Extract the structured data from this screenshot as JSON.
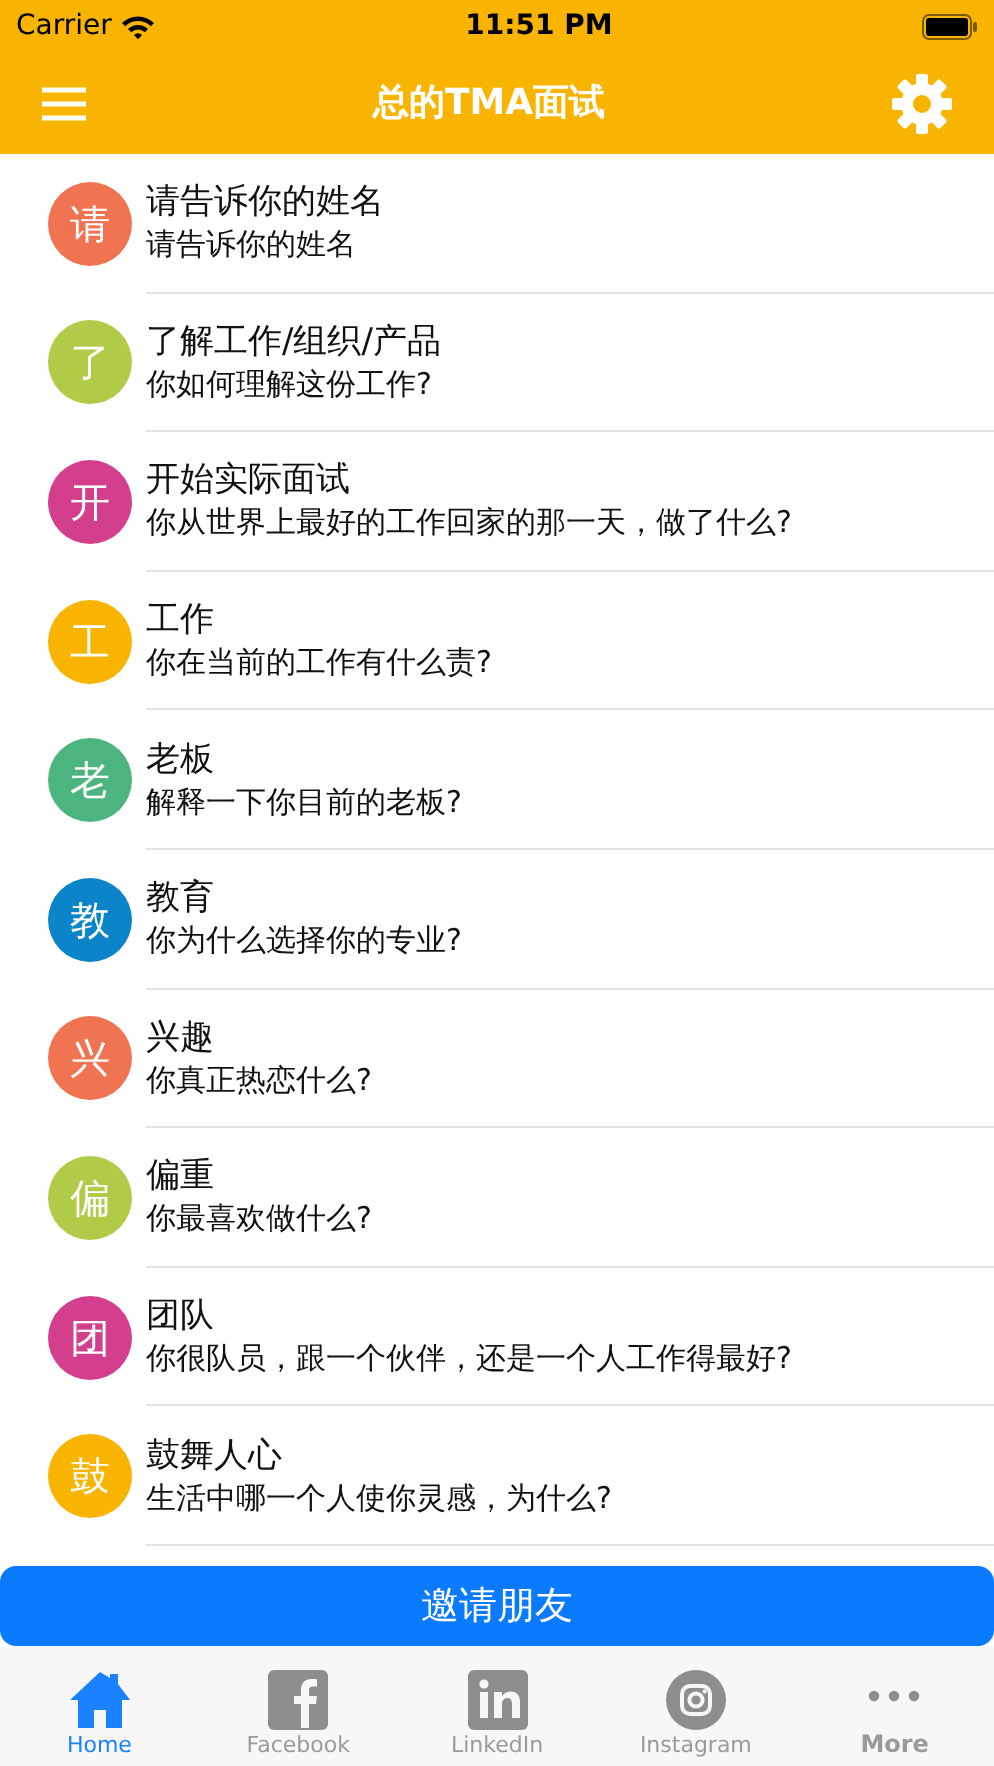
{
  "status_bar": {
    "carrier": "Carrier",
    "time": "11:51 PM"
  },
  "nav_bar": {
    "title": "总的TMA面试"
  },
  "questions": [
    {
      "avatar": "请",
      "color": "#f07452",
      "title": "请告诉你的姓名",
      "subtitle": "请告诉你的姓名"
    },
    {
      "avatar": "了",
      "color": "#afcb48",
      "title": "了解工作/组织/产品",
      "subtitle": "你如何理解这份工作?"
    },
    {
      "avatar": "开",
      "color": "#d43f8d",
      "title": "开始实际面试",
      "subtitle": "你从世界上最好的工作回家的那一天，做了什么?"
    },
    {
      "avatar": "工",
      "color": "#f9b400",
      "title": "工作",
      "subtitle": "你在当前的工作有什么责?"
    },
    {
      "avatar": "老",
      "color": "#4cb57f",
      "title": "老板",
      "subtitle": "解释一下你目前的老板?"
    },
    {
      "avatar": "教",
      "color": "#0b84c9",
      "title": "教育",
      "subtitle": "你为什么选择你的专业?"
    },
    {
      "avatar": "兴",
      "color": "#f07452",
      "title": "兴趣",
      "subtitle": "你真正热恋什么?"
    },
    {
      "avatar": "偏",
      "color": "#afcb48",
      "title": "偏重",
      "subtitle": "你最喜欢做什么?"
    },
    {
      "avatar": "团",
      "color": "#d43f8d",
      "title": "团队",
      "subtitle": "你很队员，跟一个伙伴，还是一个人工作得最好?"
    },
    {
      "avatar": "鼓",
      "color": "#f9b400",
      "title": "鼓舞人心",
      "subtitle": "生活中哪一个人使你灵感，为什么?"
    }
  ],
  "invite_button": "邀请朋友",
  "tab_bar": [
    {
      "kind": "home",
      "label": "Home",
      "selected": true
    },
    {
      "kind": "facebook",
      "label": "Facebook",
      "selected": false
    },
    {
      "kind": "linkedin",
      "label": "LinkedIn",
      "selected": false
    },
    {
      "kind": "instagram",
      "label": "Instagram",
      "selected": false
    },
    {
      "kind": "more",
      "label": "More",
      "selected": false
    }
  ]
}
